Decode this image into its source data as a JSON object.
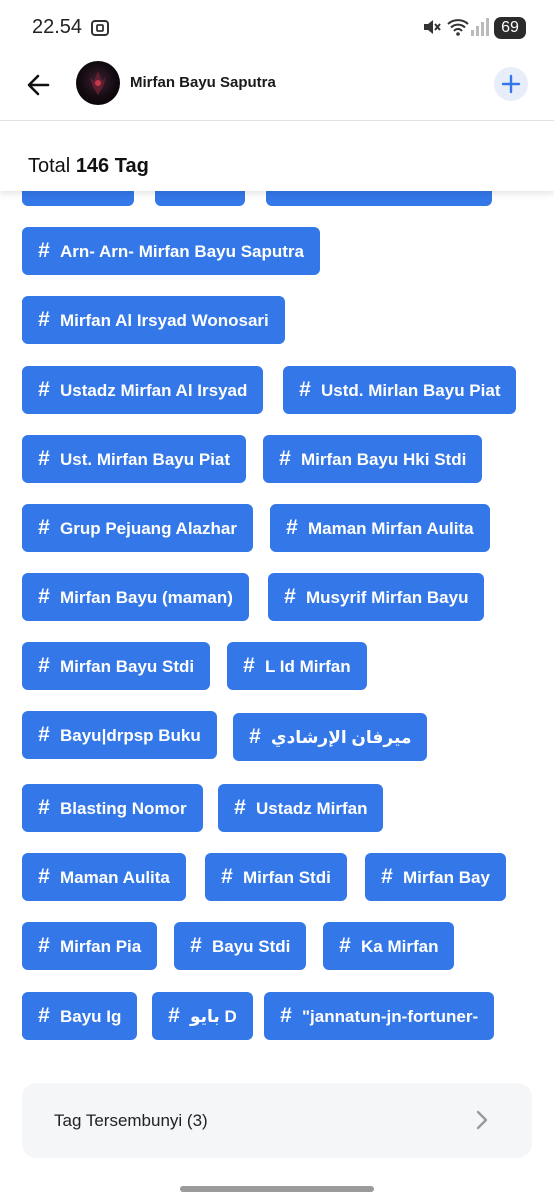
{
  "status_bar": {
    "time": "22.54",
    "battery": "69"
  },
  "header": {
    "name": "Mirfan Bayu Saputra"
  },
  "total": {
    "label": "Total",
    "count": "146 Tag"
  },
  "tags": [
    "Arn- Arn- Mirfan Bayu Saputra",
    "Mirfan Al Irsyad Wonosari",
    "Ustadz Mirfan Al Irsyad",
    "Ustd. Mirlan Bayu Piat",
    "Ust. Mirfan Bayu Piat",
    "Mirfan Bayu Hki Stdi",
    "Grup Pejuang Alazhar",
    "Maman Mirfan Aulita",
    "Mirfan Bayu (maman)",
    "Musyrif Mirfan Bayu",
    "Mirfan Bayu Stdi",
    "L Id Mirfan",
    "Bayu|drpsp Buku",
    "ميرفان الإرشادي",
    "Blasting Nomor",
    "Ustadz Mirfan",
    "Maman Aulita",
    "Mirfan Stdi",
    "Mirfan Bay",
    "Mirfan Pia",
    "Bayu Stdi",
    "Ka Mirfan",
    "Bayu Ig",
    "بايو D",
    "\"jannatun-jn-fortuner-"
  ],
  "hidden_tags": {
    "label": "Tag Tersembunyi (3)"
  },
  "colors": {
    "tag_bg": "#3377e8",
    "accent": "#3377e8"
  }
}
